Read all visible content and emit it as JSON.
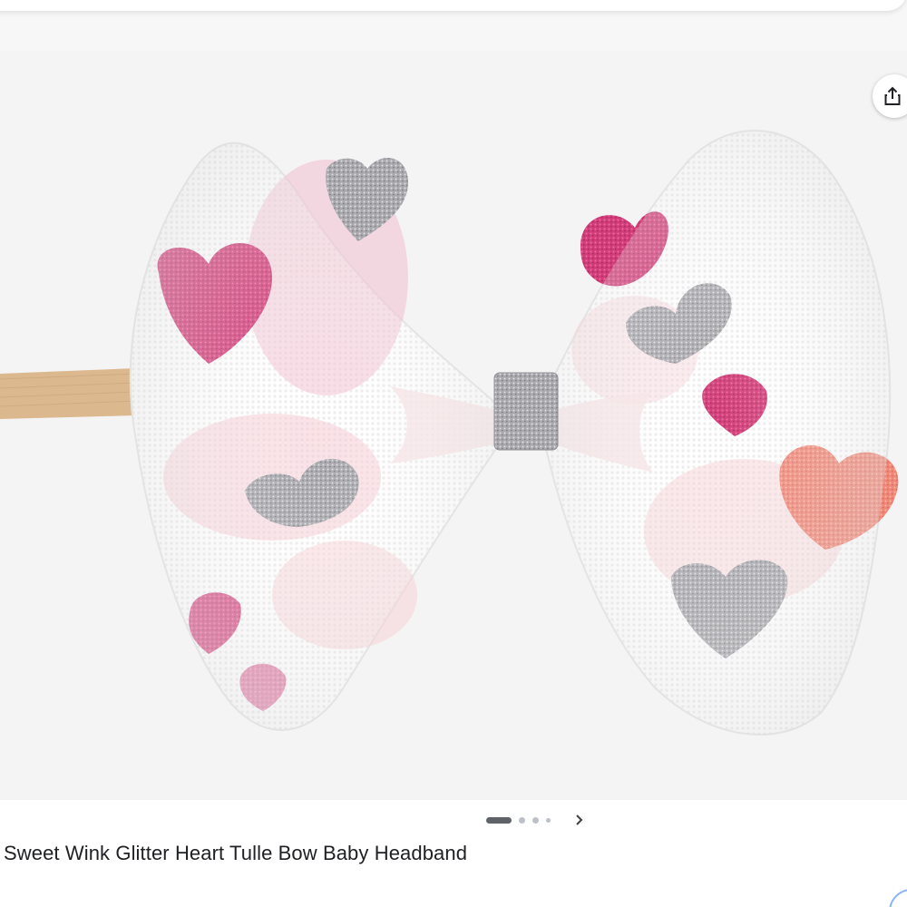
{
  "product": {
    "title": "Sweet Wink Glitter Heart Tulle Bow Baby Headband"
  },
  "gallery": {
    "image_count": 4,
    "active_index": 0
  },
  "icons": {
    "share": "share-icon",
    "next": "chevron-right-icon"
  },
  "colors": {
    "pink_glitter": "#d63a7a",
    "silver_glitter": "#a8a8ad",
    "coral": "#f08b7a",
    "band": "#d9b48a"
  }
}
